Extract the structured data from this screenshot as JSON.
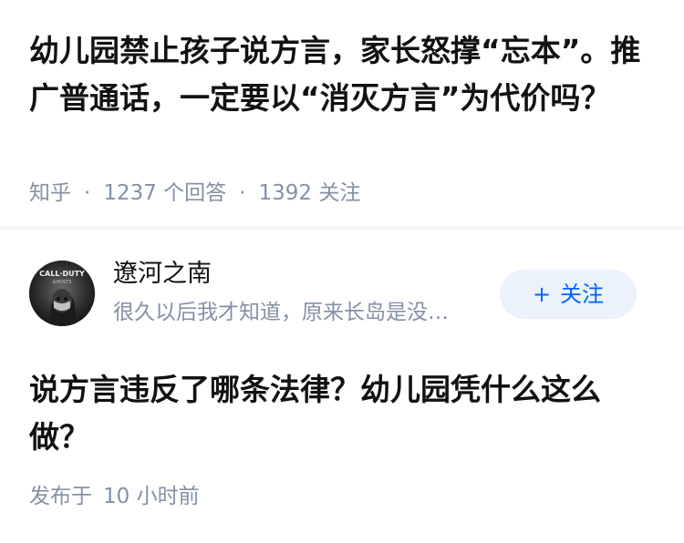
{
  "question": {
    "title": "幼儿园禁止孩子说方言，家长怒撑“忘本”。推广普通话，一定要以“消灭方言”为代价吗？",
    "meta": {
      "source": "知乎",
      "answer_count": "1237",
      "answer_label": "个回答",
      "follower_count": "1392",
      "follower_label": "关注"
    }
  },
  "author": {
    "avatar_icon": "call-of-duty-ghosts-avatar",
    "avatar_text_top": "CALL·DUTY",
    "avatar_text_bottom": "GHOSTS",
    "name": "遼河之南",
    "bio": "很久以后我才知道，原来长岛是没…",
    "follow_label": "关注"
  },
  "answer": {
    "title": "说方言违反了哪条法律？幼儿园凭什么这么做？",
    "publish_label": "发布于",
    "publish_time": "10 小时前"
  },
  "colors": {
    "title": "#121212",
    "meta": "#8590a6",
    "accent": "#0066ff",
    "follow_bg": "#ebf2fb"
  }
}
